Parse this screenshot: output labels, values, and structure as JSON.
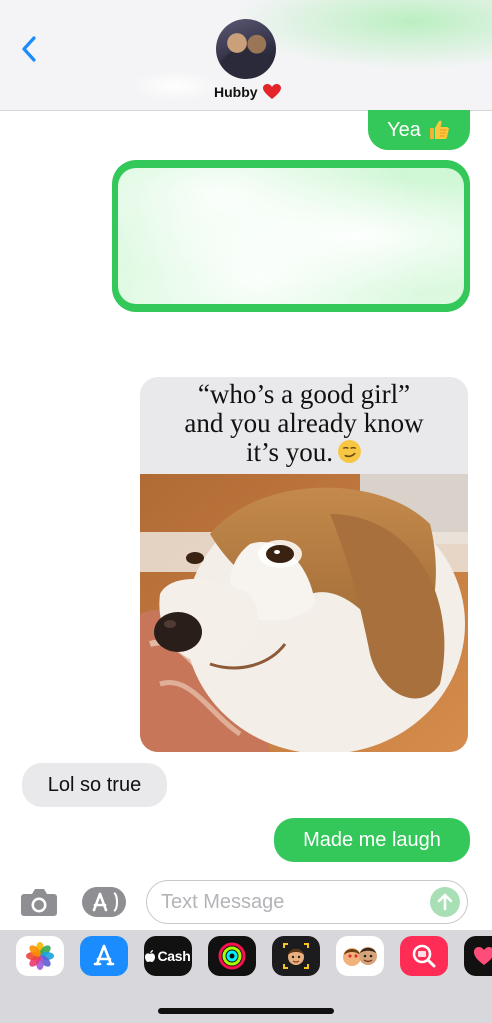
{
  "header": {
    "contact_name": "Hubby",
    "back_icon": "chevron-left-icon",
    "heart_icon": "red-heart-icon"
  },
  "messages": [
    {
      "id": "yea",
      "direction": "sent",
      "text": "Yea",
      "emoji": "thumbs-up-icon"
    },
    {
      "id": "redacted",
      "direction": "sent",
      "text": "",
      "note_visible": "blurred"
    },
    {
      "id": "meme",
      "direction": "received",
      "caption_lines": [
        "“who’s a good girl”",
        "and you already know",
        "it’s you."
      ],
      "caption_emoji": "smirking-face-icon"
    },
    {
      "id": "lol",
      "direction": "received",
      "text": "Lol so true"
    },
    {
      "id": "laugh",
      "direction": "sent",
      "text": "Made me laugh"
    }
  ],
  "input": {
    "placeholder": "Text Message",
    "value": ""
  },
  "app_drawer": {
    "cash_label": "Cash",
    "apps": [
      "photos-icon",
      "app-store-icon",
      "apple-cash-icon",
      "fitness-activity-icon",
      "memoji-icon",
      "memoji-stickers-icon",
      "image-search-icon",
      "digital-touch-icon"
    ]
  },
  "colors": {
    "sent_bubble": "#34c759",
    "received_bubble": "#e9e9eb",
    "ios_blue": "#1a8cff"
  }
}
